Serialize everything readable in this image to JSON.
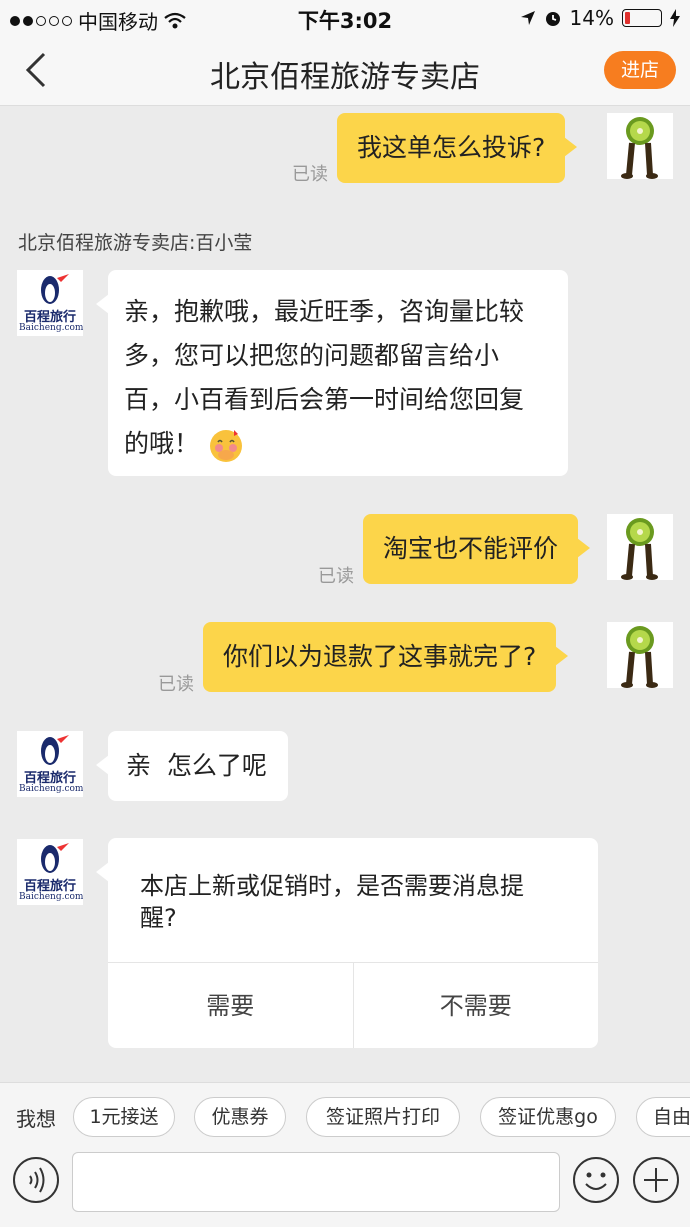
{
  "status_bar": {
    "carrier": "中国移动",
    "time": "下午3:02",
    "battery": "14%",
    "battery_level": 0.14
  },
  "nav": {
    "title": "北京佰程旅游专卖店",
    "enter_store": "进店"
  },
  "messages": {
    "m1": {
      "text": "我这单怎么投诉?",
      "read": "已读"
    },
    "sender": "北京佰程旅游专卖店:百小莹",
    "m2": {
      "lines": [
        "亲，抱歉哦，最近旺季，咨询量比较",
        "多，您可以把您的问题都留言给小",
        "百，小百看到后会第一时间给您回复",
        "的哦！"
      ]
    },
    "m3": {
      "text": "淘宝也不能评价",
      "read": "已读"
    },
    "m4": {
      "text": "你们以为退款了这事就完了?",
      "read": "已读"
    },
    "m5": {
      "text": "亲  怎么了呢"
    },
    "prompt": {
      "text": "本店上新或促销时，是否需要消息提醒?",
      "yes": "需要",
      "no": "不需要"
    },
    "store_logo": {
      "name": "百程旅行",
      "domain": "Baicheng.com"
    }
  },
  "quick": {
    "label": "我想",
    "chips": [
      "1元接送",
      "优惠券",
      "签证照片打印",
      "签证优惠go",
      "自由"
    ]
  },
  "colors": {
    "accent": "#f77d1f",
    "bubble_self": "#fcd54a",
    "background": "#ebebeb"
  }
}
